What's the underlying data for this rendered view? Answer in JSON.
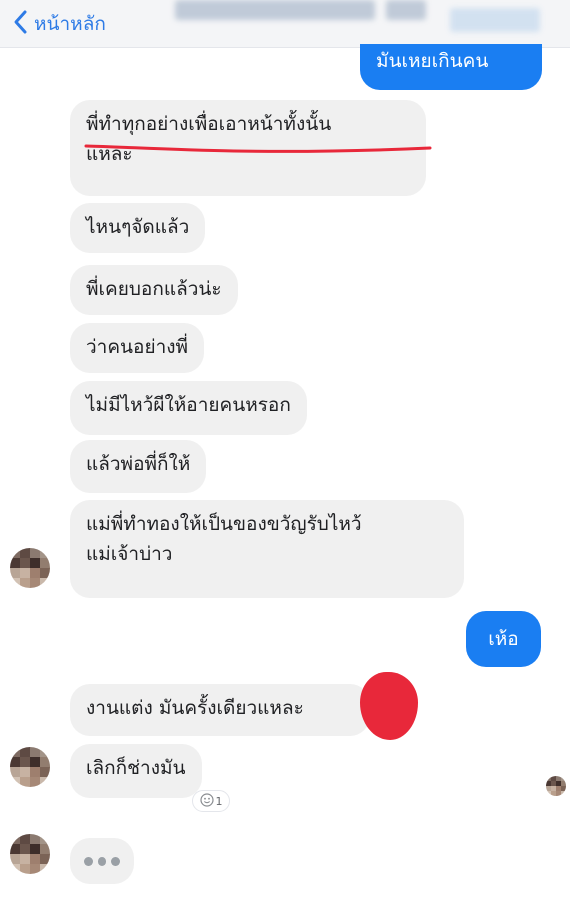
{
  "header": {
    "back_label": "หน้าหลัก"
  },
  "messages": [
    {
      "side": "out",
      "text": "มันเหยเกินคน"
    },
    {
      "side": "in",
      "line1": "พี่ทำทุกอย่างเพื่อเอาหน้าทั้งนั้น",
      "line2": "แหละ"
    },
    {
      "side": "in",
      "text": "ไหนๆจัดแล้ว"
    },
    {
      "side": "in",
      "text": "พี่เคยบอกแล้วน่ะ"
    },
    {
      "side": "in",
      "text": "ว่าคนอย่างพี่"
    },
    {
      "side": "in",
      "text": "ไม่มีไหว้ผีให้อายคนหรอก"
    },
    {
      "side": "in",
      "text": "แล้วพ่อพี่ก็ให้"
    },
    {
      "side": "in",
      "line1": "แม่พี่ทำทองให้เป็นของขวัญรับไหว้",
      "line2": "แม่เจ้าบ่าว"
    },
    {
      "side": "out",
      "text": "เห้อ"
    },
    {
      "side": "in",
      "text": "งานแต่ง มันครั้งเดียวแหละ"
    },
    {
      "side": "in",
      "text": "เลิกก็ช่างมัน"
    }
  ],
  "reaction": {
    "icon": "smiley-icon",
    "count": "1"
  },
  "typing": {
    "icon": "typing-dots-icon"
  },
  "colors": {
    "accent": "#1a7ef2",
    "incoming": "#f0f0f0",
    "annotation": "#e8283a"
  }
}
